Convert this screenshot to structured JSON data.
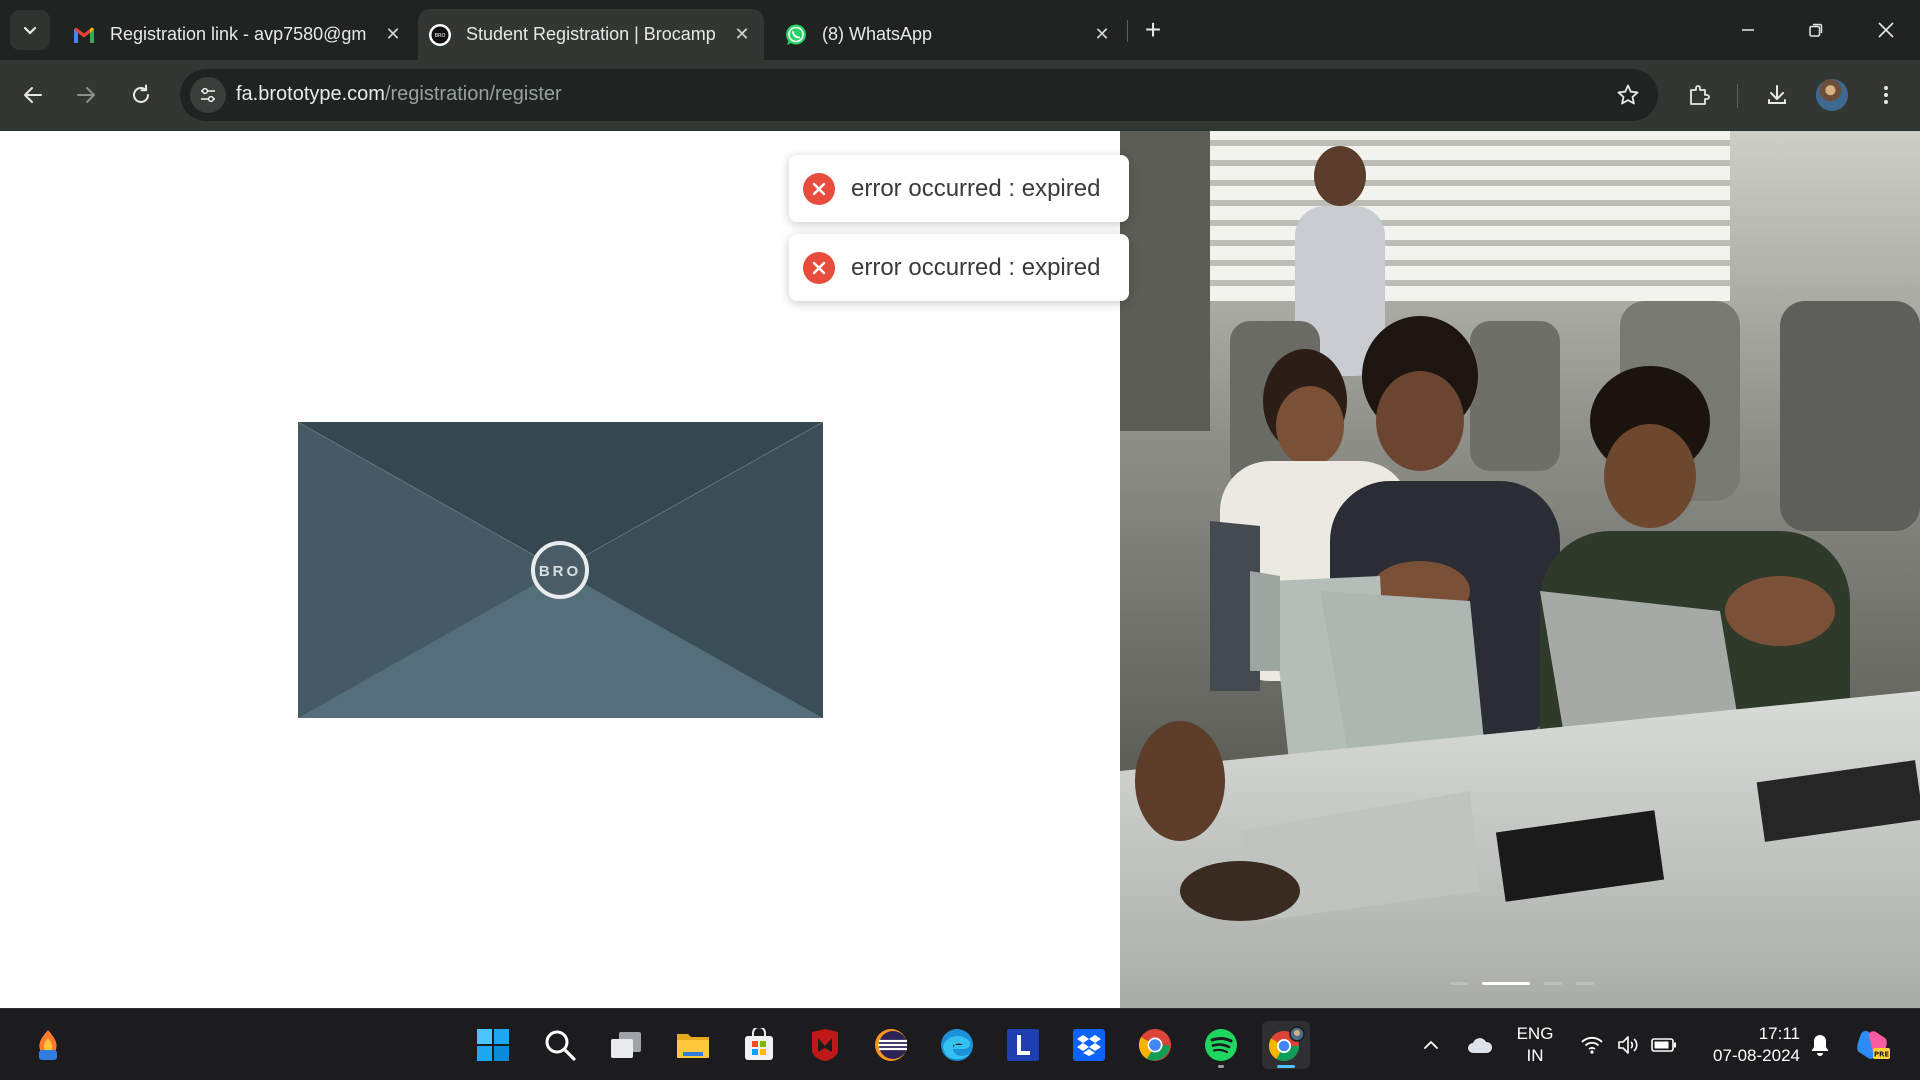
{
  "browser": {
    "tabs": [
      {
        "title": "Registration link - avp7580@gm",
        "favicon": "gmail-icon",
        "active": false
      },
      {
        "title": "Student Registration | Brocamp",
        "favicon": "brototype-icon",
        "active": true
      },
      {
        "title": "(8) WhatsApp",
        "favicon": "whatsapp-icon",
        "active": false
      }
    ],
    "address": {
      "host": "fa.brototype.com",
      "path": "/registration/register"
    }
  },
  "page": {
    "envelope_logo": "BRO",
    "toasts": [
      {
        "type": "error",
        "message": "error occurred : expired"
      },
      {
        "type": "error",
        "message": "error occurred : expired"
      }
    ],
    "hero_image": "Students working on laptops in a classroom",
    "carousel": {
      "count": 4,
      "active_index": 1
    }
  },
  "taskbar": {
    "apps": [
      "widgets-icon",
      "start-icon",
      "search-icon",
      "task-view-icon",
      "file-explorer-icon",
      "microsoft-store-icon",
      "mcafee-icon",
      "eclipse-icon",
      "edge-icon",
      "l-app-icon",
      "dropbox-icon",
      "chrome-icon",
      "spotify-icon",
      "chrome-profile-icon"
    ],
    "language": {
      "line1": "ENG",
      "line2": "IN"
    },
    "time": "17:11",
    "date": "07-08-2024"
  },
  "colors": {
    "chrome_dark": "#1f2321",
    "toolbar": "#323734",
    "envelope_top": "#36474f",
    "envelope_side": "#455a64",
    "envelope_bottom": "#546e7a",
    "error_red": "#e74c3c"
  }
}
